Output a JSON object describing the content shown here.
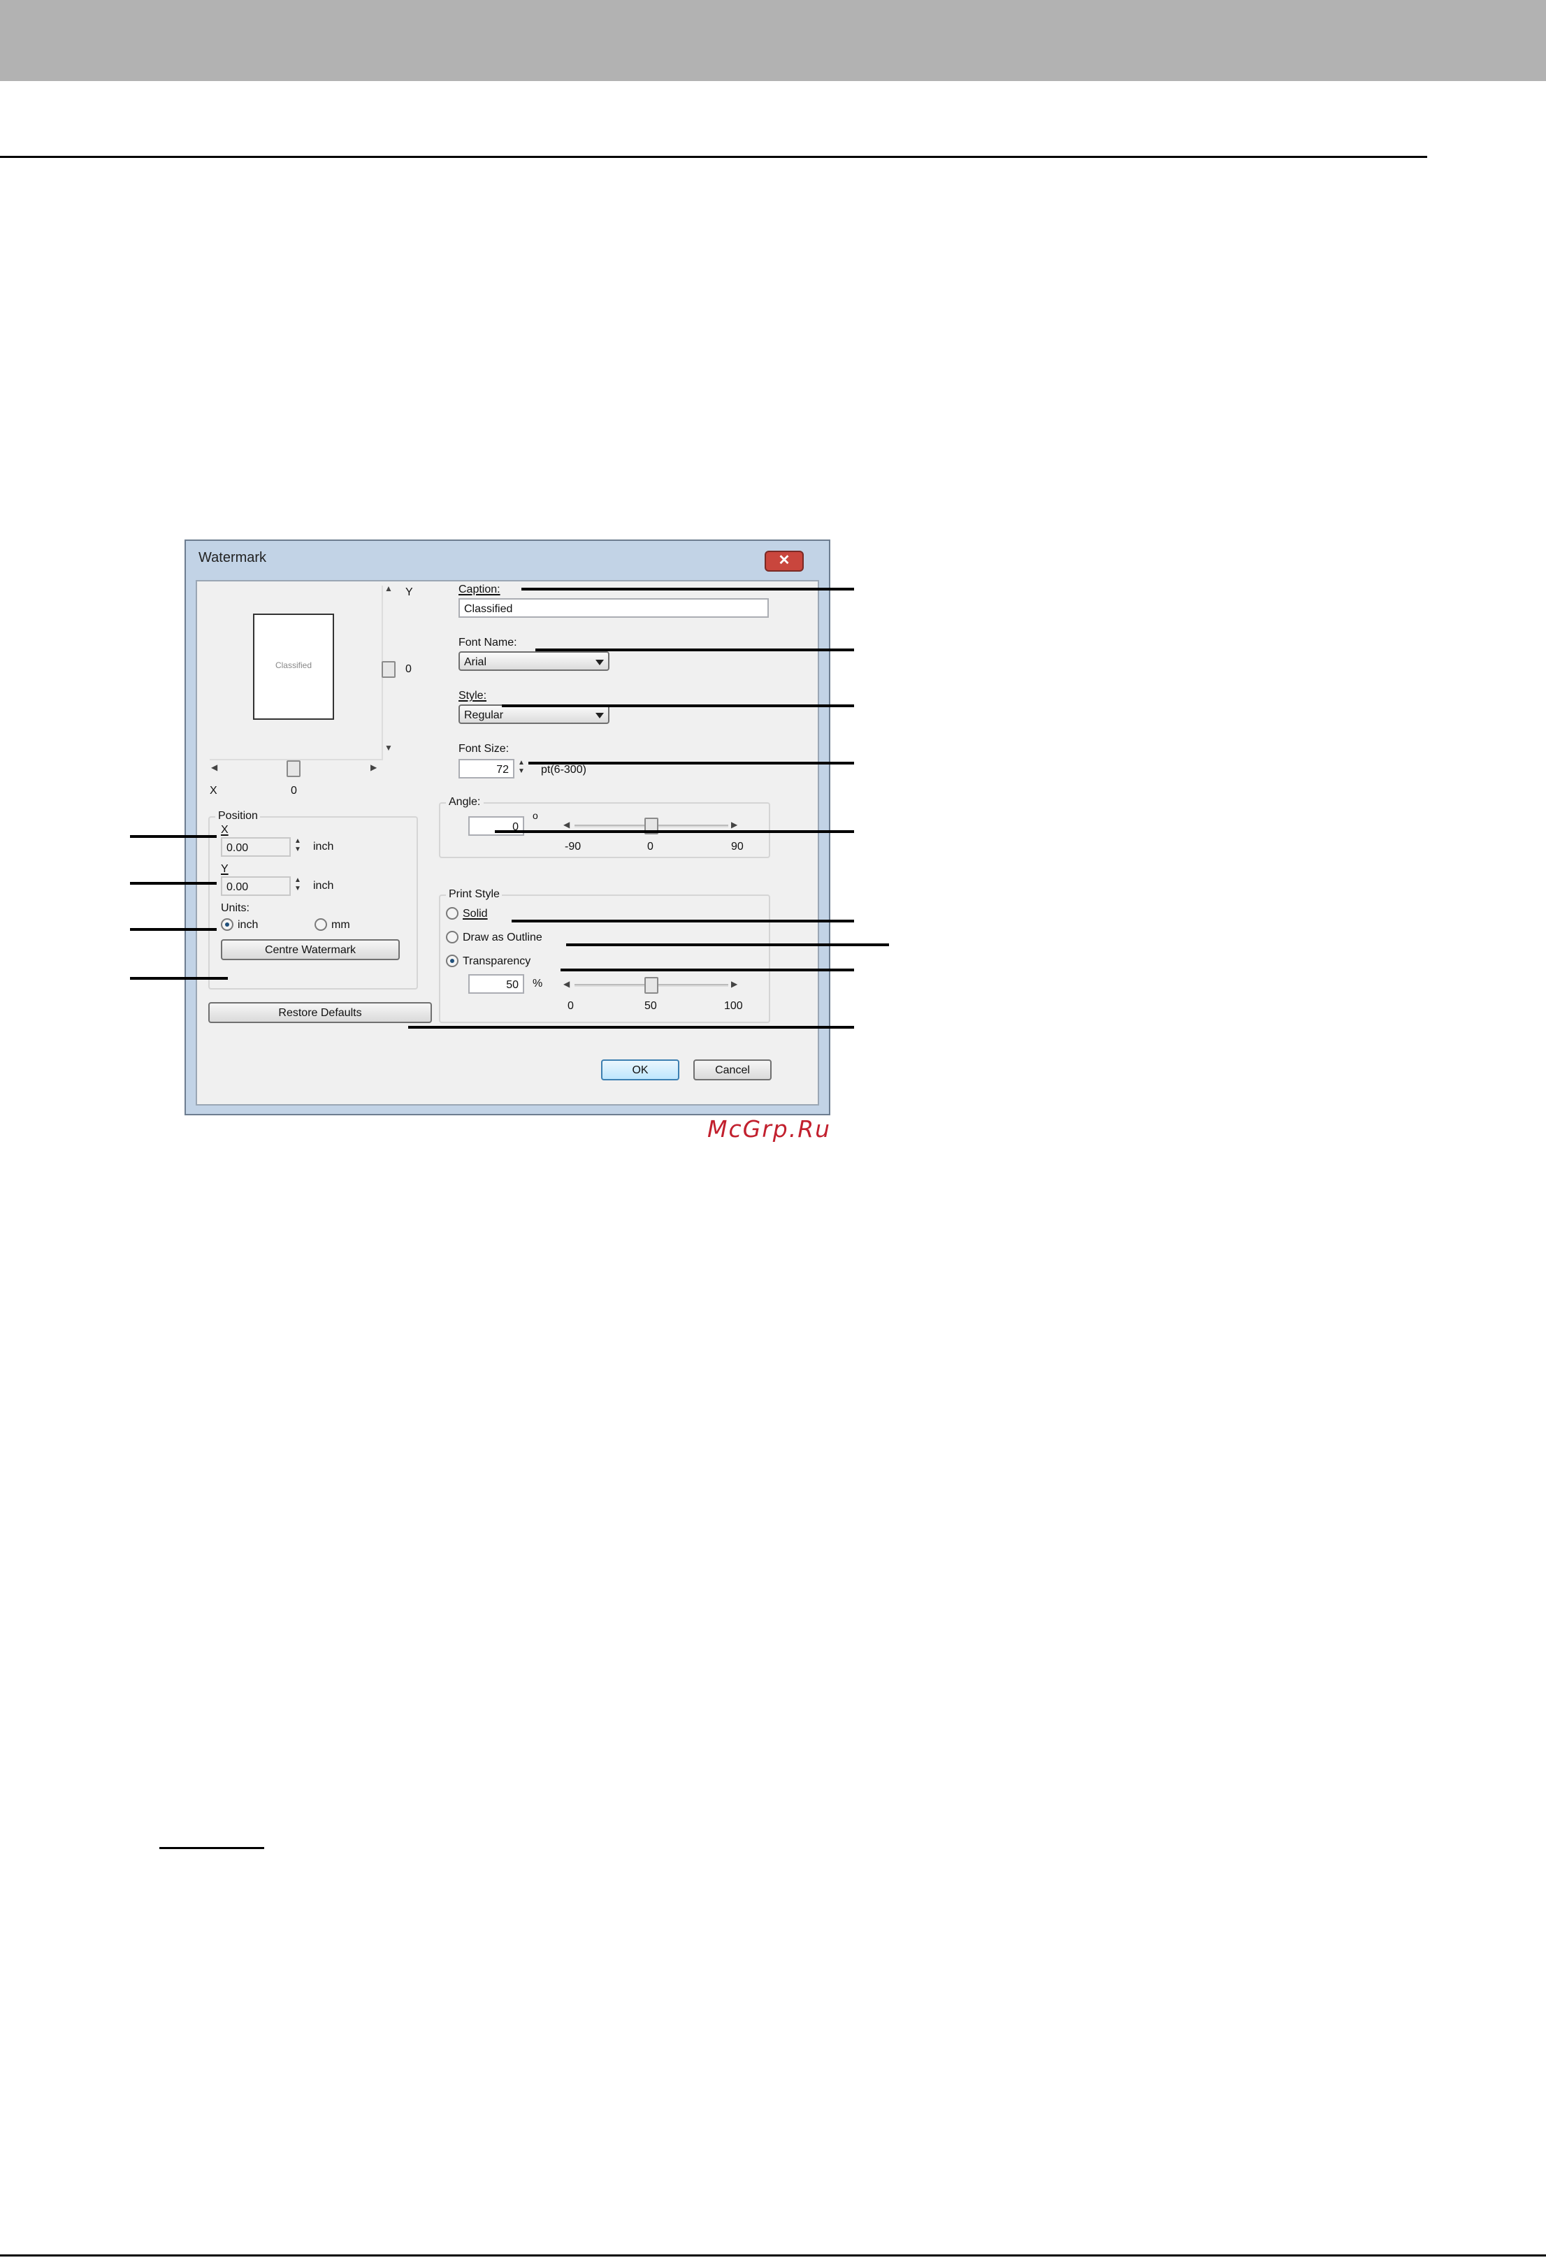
{
  "dialog": {
    "title": "Watermark",
    "close_glyph": "✕",
    "preview": {
      "caption_text": "Classified",
      "y_axis_label": "Y",
      "y_value": "0",
      "x_axis_label": "X",
      "x_value": "0"
    },
    "position": {
      "group_label": "Position",
      "x_label": "X",
      "x_value": "0.00",
      "x_unit": "inch",
      "y_label": "Y",
      "y_value": "0.00",
      "y_unit": "inch",
      "units_label": "Units:",
      "unit_inch": "inch",
      "unit_mm": "mm",
      "selected_unit": "inch",
      "centre_button": "Centre Watermark"
    },
    "restore_button": "Restore Defaults",
    "caption": {
      "label": "Caption:",
      "value": "Classified"
    },
    "font_name": {
      "label": "Font Name:",
      "value": "Arial"
    },
    "style": {
      "label": "Style:",
      "value": "Regular"
    },
    "font_size": {
      "label": "Font Size:",
      "value": "72",
      "range": "pt(6-300)"
    },
    "angle": {
      "label": "Angle:",
      "value": "0",
      "degree_symbol": "o",
      "min_tick": "-90",
      "mid_tick": "0",
      "max_tick": "90",
      "slider_level": 0
    },
    "print_style": {
      "group_label": "Print Style",
      "solid": "Solid",
      "draw_as_outline": "Draw as Outline",
      "transparency": "Transparency",
      "selected": "Transparency",
      "transparency_value": "50",
      "percent": "%",
      "min_tick": "0",
      "mid_tick": "50",
      "max_tick": "100",
      "slider_level": 50
    },
    "ok_button": "OK",
    "cancel_button": "Cancel"
  },
  "watermark_text": "McGrp.Ru",
  "colors": {
    "header_band": "#b2b2b2",
    "dialog_frame": "#c2d3e6",
    "close_button": "#c9463d",
    "watermark": "#c2202e"
  },
  "icons": [
    "close-icon",
    "chevron-down-icon",
    "spin-up-icon",
    "spin-down-icon",
    "arrow-left-icon",
    "arrow-right-icon",
    "arrow-up-icon",
    "arrow-down-icon"
  ]
}
